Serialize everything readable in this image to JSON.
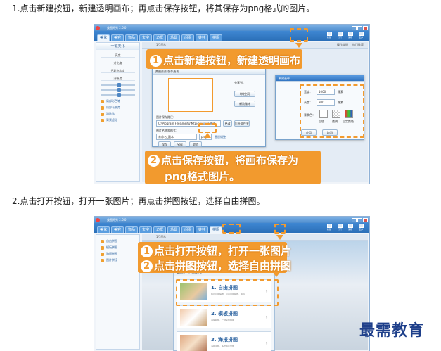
{
  "steps": [
    {
      "text": "1.点击新建按钮，新建透明画布；再点击保存按钮，将其保存为png格式的图片。"
    },
    {
      "text": "2.点击打开按钮，打开一张图片；再点击拼图按钮，选择自由拼图。"
    }
  ],
  "watermark": "最需教育",
  "shot1": {
    "app_title": "美图秀秀 2.6.0",
    "menu_tabs": [
      "美化",
      "美容",
      "饰品",
      "文字",
      "边框",
      "场景",
      "闪图",
      "娃娃",
      "拼图"
    ],
    "tool_buttons": [
      "新建",
      "打开",
      "保存",
      "更多"
    ],
    "side_panel": {
      "header": "一键美化",
      "items": [
        "亮度",
        "对比度",
        "色彩饱和度",
        "清晰度"
      ],
      "sliders": [
        "红",
        "绿",
        "蓝"
      ],
      "options": [
        "局部彩色笔",
        "局部马赛克",
        "消除笔",
        "背景虚化"
      ]
    },
    "canvas_toolbar": [
      "1/1图片",
      "操作说明",
      "热门推荐"
    ],
    "save_dialog": {
      "title": "美图秀秀 保存选项",
      "path_label": "图片保存路径：",
      "path_value": "C:\\Program Files\\meitu\\Mtpic\\xiuxiu\\测试",
      "change_button": "更改",
      "open_folder_button": "打开文件夹",
      "name_label": "图片名称和格式：",
      "name_value": "未命名_副本",
      "format_value": "png",
      "quality_link": "画质调整",
      "save_button": "保存",
      "save_as_button": "另存",
      "cancel_button": "取消",
      "share_title": "分享到：",
      "share_items": [
        "QQ空间",
        "新浪微博"
      ]
    },
    "new_dialog": {
      "title": "新建画布",
      "width_label": "宽度：",
      "width_value": "1000",
      "height_label": "高度：",
      "height_value": "800",
      "unit": "像素",
      "bg_label": "背景色：",
      "color_options": [
        "白色",
        "透明",
        "自定颜色"
      ],
      "ok_button": "应用",
      "cancel_button": "取消"
    },
    "callout_1": {
      "number": "1",
      "text": "点击新建按钮，新建透明画布"
    },
    "callout_2": {
      "number": "2",
      "line1": "点击保存按钮，将画布保存为",
      "line2": "png格式图片。"
    }
  },
  "shot2": {
    "app_title": "美图秀秀 2.6.0",
    "menu_tabs": [
      "美化",
      "美容",
      "饰品",
      "文字",
      "边框",
      "场景",
      "闪图",
      "娃娃",
      "拼图"
    ],
    "tool_buttons": [
      "新建",
      "打开",
      "保存",
      "更多"
    ],
    "side_options": [
      "自由拼图",
      "模板拼图",
      "海报拼图",
      "图片拼接"
    ],
    "canvas_toolbar": [
      "1/1图片"
    ],
    "callout_1": {
      "number": "1",
      "text": "点击打开按钮，打开一张图片"
    },
    "callout_2": {
      "number": "2",
      "text": "点击拼图按钮，选择自由拼图"
    },
    "puzzle_dialog": {
      "header": "请选择一个拼图样式",
      "items": [
        {
          "label": "1. 自由拼图",
          "desc": "照片自由摆放，可以自由拖拽、旋转"
        },
        {
          "label": "2. 模板拼图",
          "desc": "选择模板，一键完成拼图"
        },
        {
          "label": "3. 海报拼图",
          "desc": "海报风格，多张照片合成"
        }
      ]
    }
  }
}
